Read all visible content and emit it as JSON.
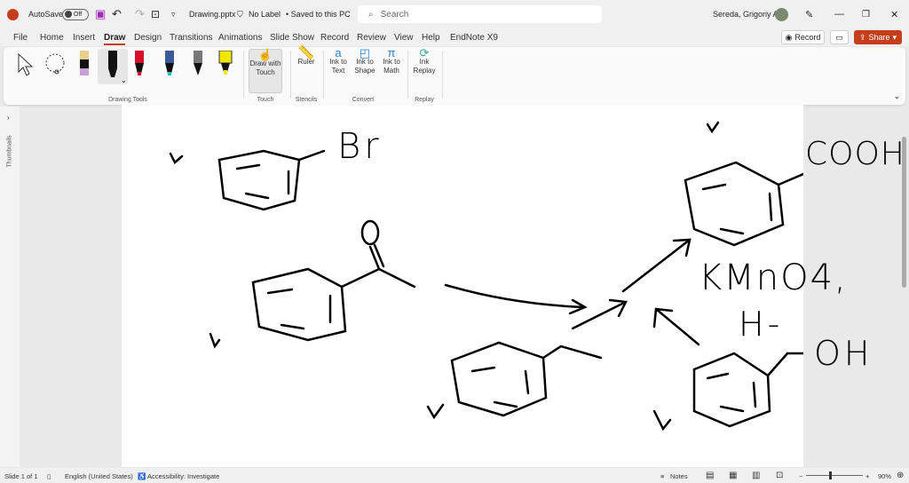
{
  "titlebar": {
    "autosave": "AutoSave",
    "toggle": "Off",
    "filename": "Drawing.pptx",
    "label": "No Label",
    "saved": "• Saved to this PC",
    "search_placeholder": "Search",
    "user": "Sereda, Grigoriy A"
  },
  "tabs": [
    "File",
    "Home",
    "Insert",
    "Draw",
    "Design",
    "Transitions",
    "Animations",
    "Slide Show",
    "Record",
    "Review",
    "View",
    "Help",
    "EndNote X9"
  ],
  "actions": {
    "record": "Record",
    "share": "Share"
  },
  "ribbon": {
    "draw_with_touch": "Draw with Touch",
    "ruler": "Ruler",
    "ink_to_text": "Ink to Text",
    "ink_to_shape": "Ink to Shape",
    "ink_to_math": "Ink to Math",
    "ink_replay": "Ink Replay",
    "groups": {
      "drawing_tools": "Drawing Tools",
      "touch": "Touch",
      "stencils": "Stencils",
      "convert": "Convert",
      "replay": "Replay"
    }
  },
  "thumbnails_label": "Thumbnails",
  "slide_ink": {
    "br": "Br",
    "cooh": "COOH",
    "reagent1": "KMnO4,",
    "reagent2": "H-",
    "oh": "OH",
    "o": "O"
  },
  "status": {
    "slide": "Slide 1 of 1",
    "language": "English (United States)",
    "accessibility": "Accessibility: Investigate",
    "notes": "Notes",
    "zoom": "90%"
  },
  "colors": {
    "accent": "#c43e1c"
  }
}
